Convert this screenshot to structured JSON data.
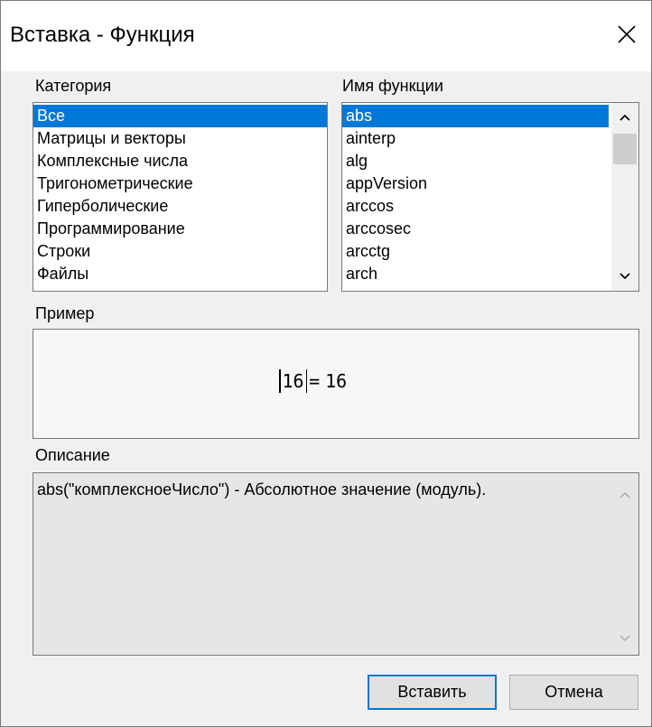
{
  "window": {
    "title": "Вставка - Функция"
  },
  "category": {
    "label": "Категория",
    "items": [
      {
        "label": "Все",
        "selected": true
      },
      {
        "label": "Матрицы и векторы",
        "selected": false
      },
      {
        "label": "Комплексные числа",
        "selected": false
      },
      {
        "label": "Тригонометрические",
        "selected": false
      },
      {
        "label": "Гиперболические",
        "selected": false
      },
      {
        "label": "Программирование",
        "selected": false
      },
      {
        "label": "Строки",
        "selected": false
      },
      {
        "label": "Файлы",
        "selected": false
      }
    ]
  },
  "function_name": {
    "label": "Имя функции",
    "items": [
      {
        "label": "abs",
        "selected": true
      },
      {
        "label": "ainterp",
        "selected": false
      },
      {
        "label": "alg",
        "selected": false
      },
      {
        "label": "appVersion",
        "selected": false
      },
      {
        "label": "arccos",
        "selected": false
      },
      {
        "label": "arccosec",
        "selected": false
      },
      {
        "label": "arcctg",
        "selected": false
      },
      {
        "label": "arch",
        "selected": false
      }
    ]
  },
  "example": {
    "label": "Пример",
    "argument": "16",
    "equals": "=",
    "result": "16"
  },
  "description": {
    "label": "Описание",
    "text": "abs(\"комплексноеЧисло\") - Абсолютное значение (модуль)."
  },
  "buttons": {
    "insert": "Вставить",
    "cancel": "Отмена"
  },
  "colors": {
    "selection": "#0078d7",
    "dialog_bg": "#f0f0f0"
  },
  "icons": {
    "close": "close-icon",
    "scroll_up": "chevron-up-icon",
    "scroll_down": "chevron-down-icon"
  }
}
